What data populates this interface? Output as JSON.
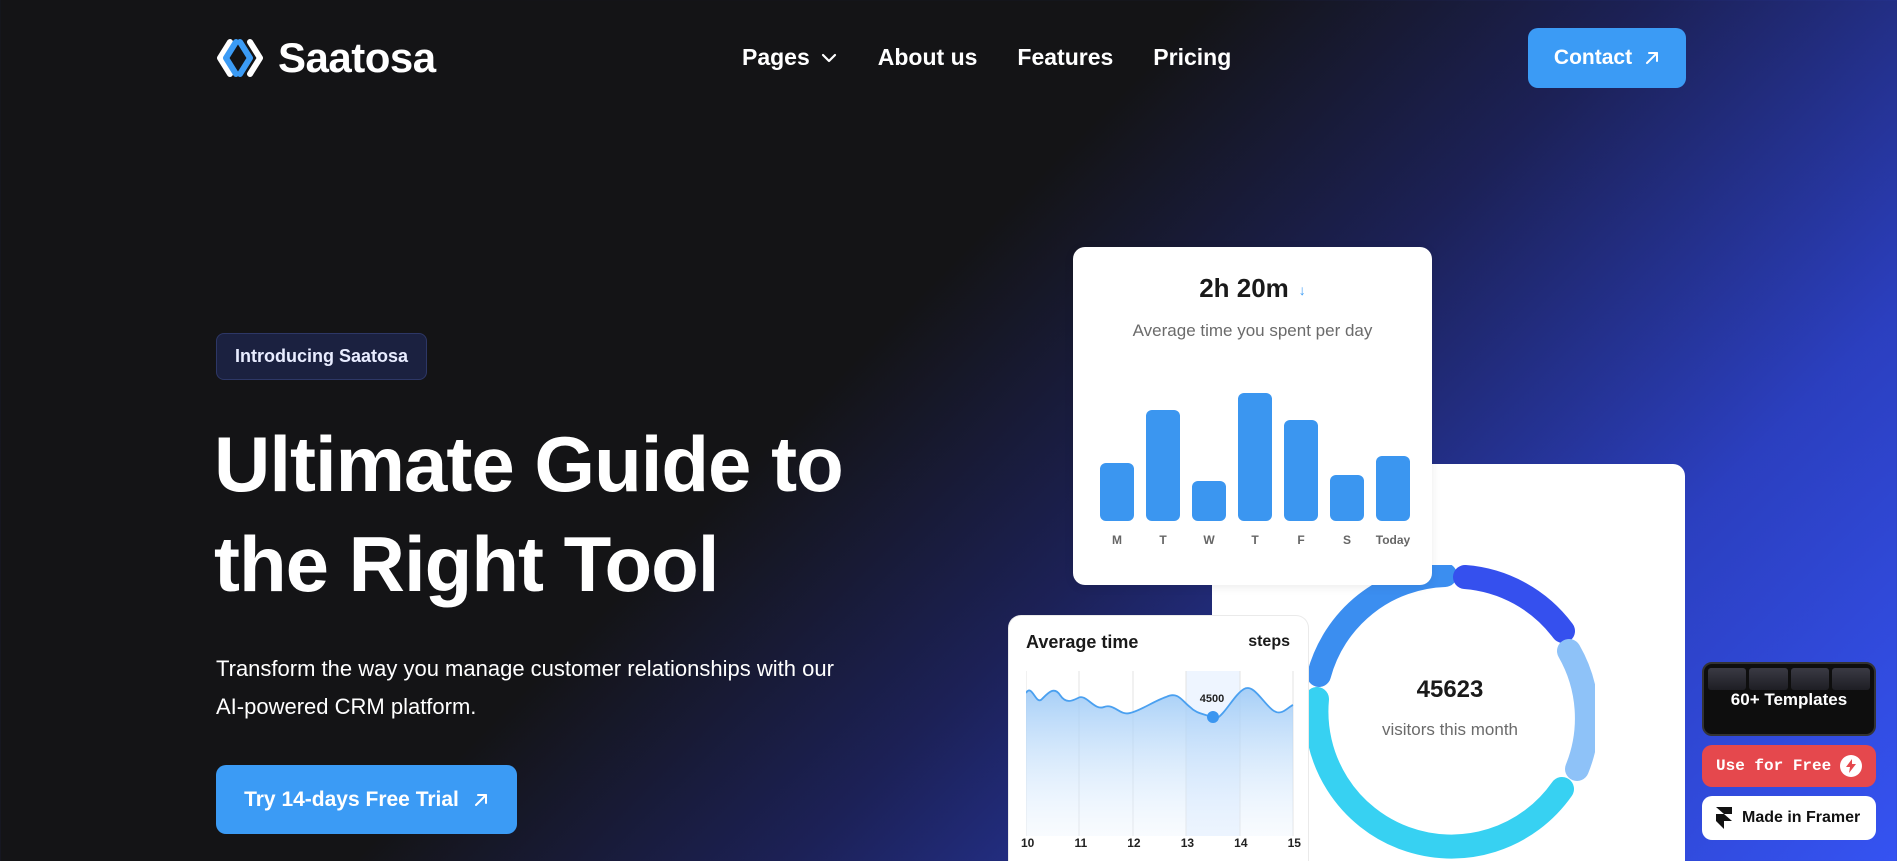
{
  "brand": {
    "name": "Saatosa",
    "accent": "#3b9bf5"
  },
  "nav": {
    "items": [
      {
        "label": "Pages",
        "has_dropdown": true
      },
      {
        "label": "About us"
      },
      {
        "label": "Features"
      },
      {
        "label": "Pricing"
      }
    ],
    "contact_label": "Contact"
  },
  "hero": {
    "badge": "Introducing Saatosa",
    "title_line1": "Ultimate Guide to",
    "title_line2": "the Right Tool",
    "subtitle_line1": "Transform the way you manage customer relationships with our",
    "subtitle_line2": "AI-powered CRM platform.",
    "cta_label": "Try 14-days Free Trial"
  },
  "time_card": {
    "value": "2h 20m",
    "label": "Average time you spent per day",
    "chart_data": {
      "type": "bar",
      "categories": [
        "M",
        "T",
        "W",
        "T",
        "F",
        "S",
        "Today"
      ],
      "values": [
        0.45,
        0.87,
        0.31,
        1.0,
        0.79,
        0.36,
        0.51
      ]
    }
  },
  "avg_card": {
    "title": "Average time",
    "unit": "steps",
    "tooltip_value": "4500",
    "chart_data": {
      "type": "area",
      "x": [
        "10",
        "11",
        "12",
        "13",
        "14",
        "15"
      ],
      "highlight_x": "13.5"
    }
  },
  "visitors": {
    "value": "45623",
    "label": "visitors this month"
  },
  "framer": {
    "templates_label": "60+ Templates",
    "use_free_label": "Use for Free",
    "made_in_label": "Made in Framer"
  }
}
